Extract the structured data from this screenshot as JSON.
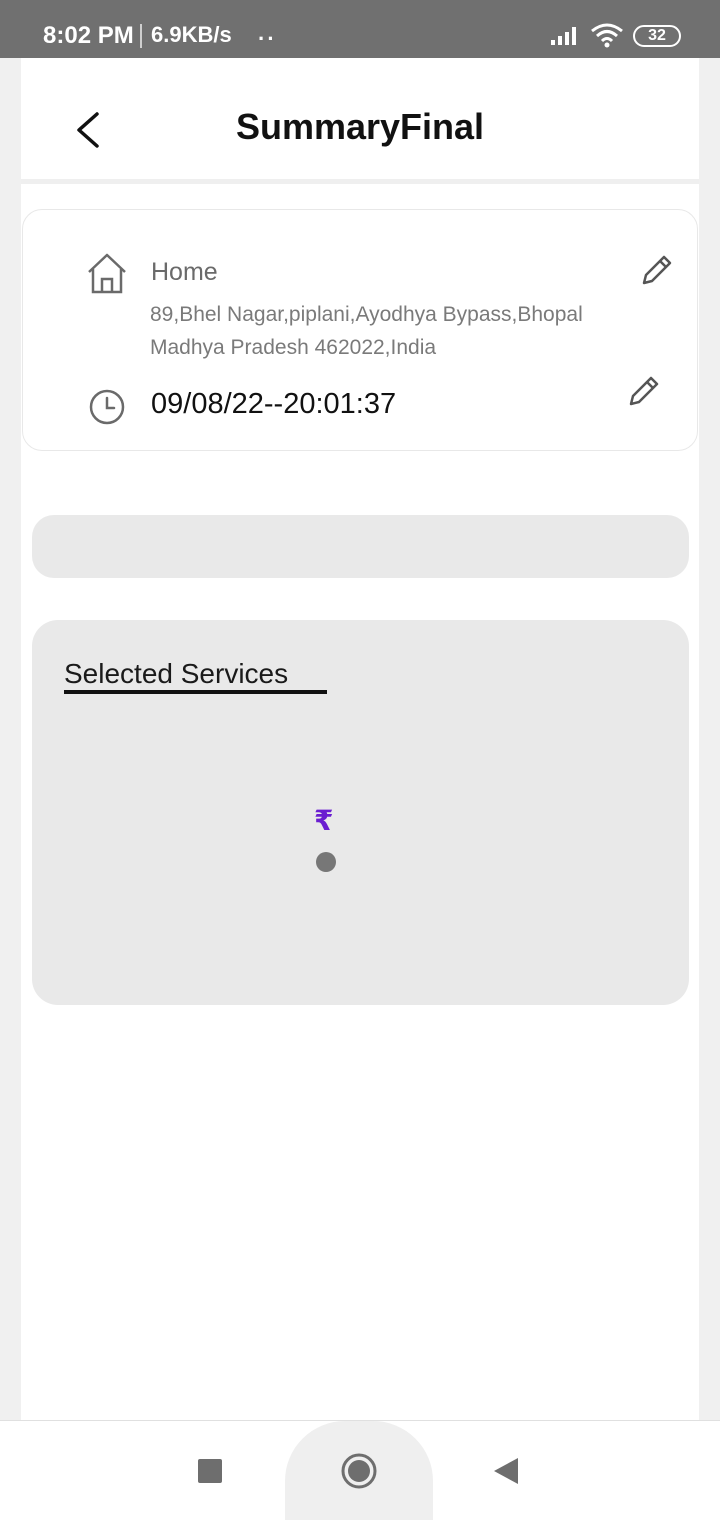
{
  "status_bar": {
    "time": "8:02 PM",
    "speed": "6.9KB/s",
    "dots": "··",
    "battery": "32"
  },
  "header": {
    "title": "SummaryFinal"
  },
  "address": {
    "label": "Home",
    "line1": "89,Bhel Nagar,piplani,Ayodhya Bypass,Bhopal",
    "line2": "Madhya Pradesh 462022,India"
  },
  "schedule": {
    "datetime": "09/08/22--20:01:37"
  },
  "services": {
    "title": "Selected Services",
    "currency": "₹"
  },
  "colors": {
    "status_bar": "#707070",
    "card_grey": "#e9e9e9",
    "rupee": "#6a1ed0",
    "loading_dot": "#777777"
  }
}
